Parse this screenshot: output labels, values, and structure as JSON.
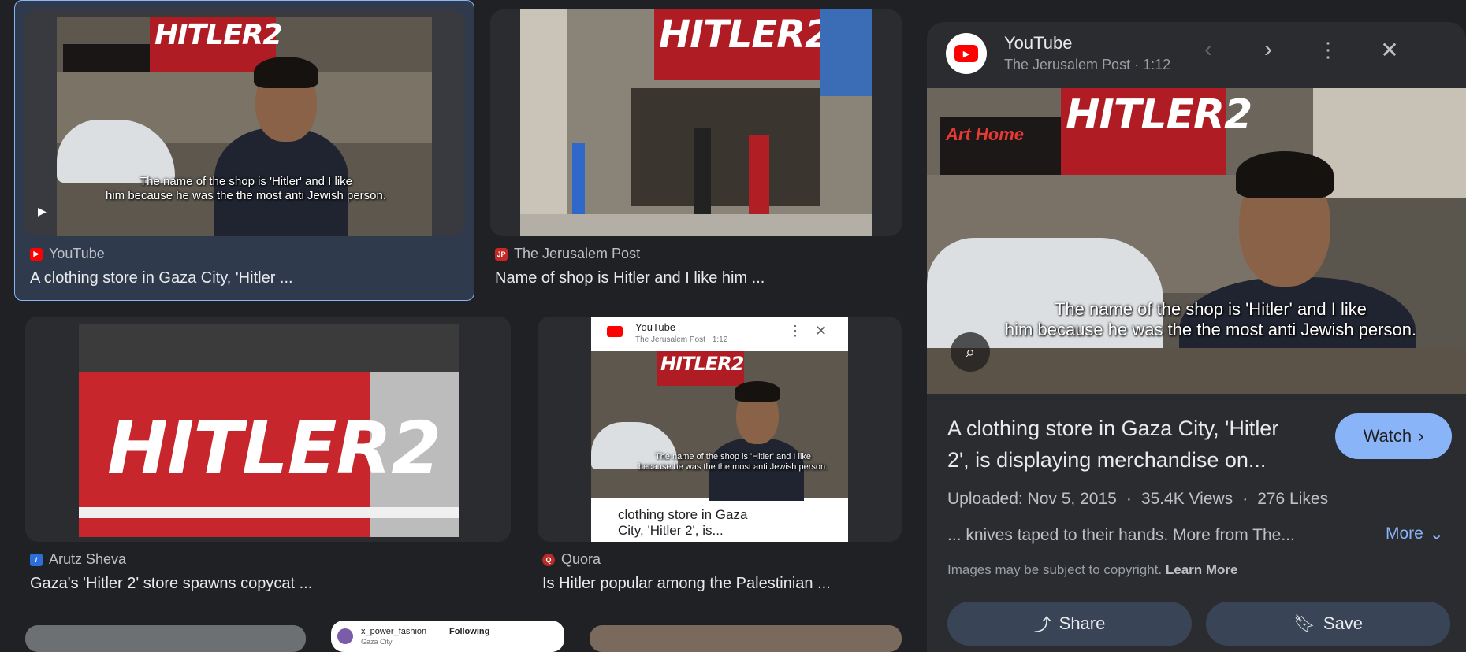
{
  "results": [
    {
      "source": "YouTube",
      "title": "A clothing store in Gaza City, 'Hitler ...",
      "sign": "HITLER2",
      "caption_line1": "The name of the shop is 'Hitler' and I like",
      "caption_line2": "him because he was the the most anti Jewish person."
    },
    {
      "source": "The Jerusalem Post",
      "title": "Name of shop is Hitler and I like him ...",
      "sign": "HITLER2",
      "favicon": "JP"
    },
    {
      "source": "Arutz Sheva",
      "title": "Gaza's 'Hitler 2' store spawns copycat ...",
      "sign": "HITLER2"
    },
    {
      "source": "Quora",
      "title": "Is Hitler popular among the Palestinian ...",
      "inner_source": "YouTube",
      "inner_sub": "The Jerusalem Post · 1:12",
      "inner_sign": "HITLER2",
      "inner_cap1": "The name of the shop is 'Hitler' and I like",
      "inner_cap2": "because he was the the most anti Jewish person.",
      "inner_title1": "clothing store in Gaza",
      "inner_title2": "City, 'Hitler 2', is..."
    }
  ],
  "partial": {
    "user": "x_power_fashion",
    "following": "Following",
    "location": "Gaza City"
  },
  "preview": {
    "source": "YouTube",
    "subtitle": "The Jerusalem Post · 1:12",
    "sign": "HITLER2",
    "art_home": "Art Home",
    "caption_line1": "The name of the shop is 'Hitler' and I like",
    "caption_line2": "him because he was the the most anti Jewish person.",
    "title_line1": "A clothing store in Gaza City, 'Hitler",
    "title_line2": "2', is displaying merchandise on...",
    "watch_label": "Watch",
    "uploaded": "Uploaded: Nov 5, 2015",
    "views": "35.4K Views",
    "likes": "276 Likes",
    "snippet": "... knives taped to their hands. More from The...",
    "more_label": "More",
    "copyright": "Images may be subject to copyright.",
    "learn_more": "Learn More",
    "share_label": "Share",
    "save_label": "Save"
  },
  "colors": {
    "accent": "#8ab4f8",
    "youtube": "#ff0000",
    "background": "#202124",
    "panel": "#2b2c30"
  }
}
